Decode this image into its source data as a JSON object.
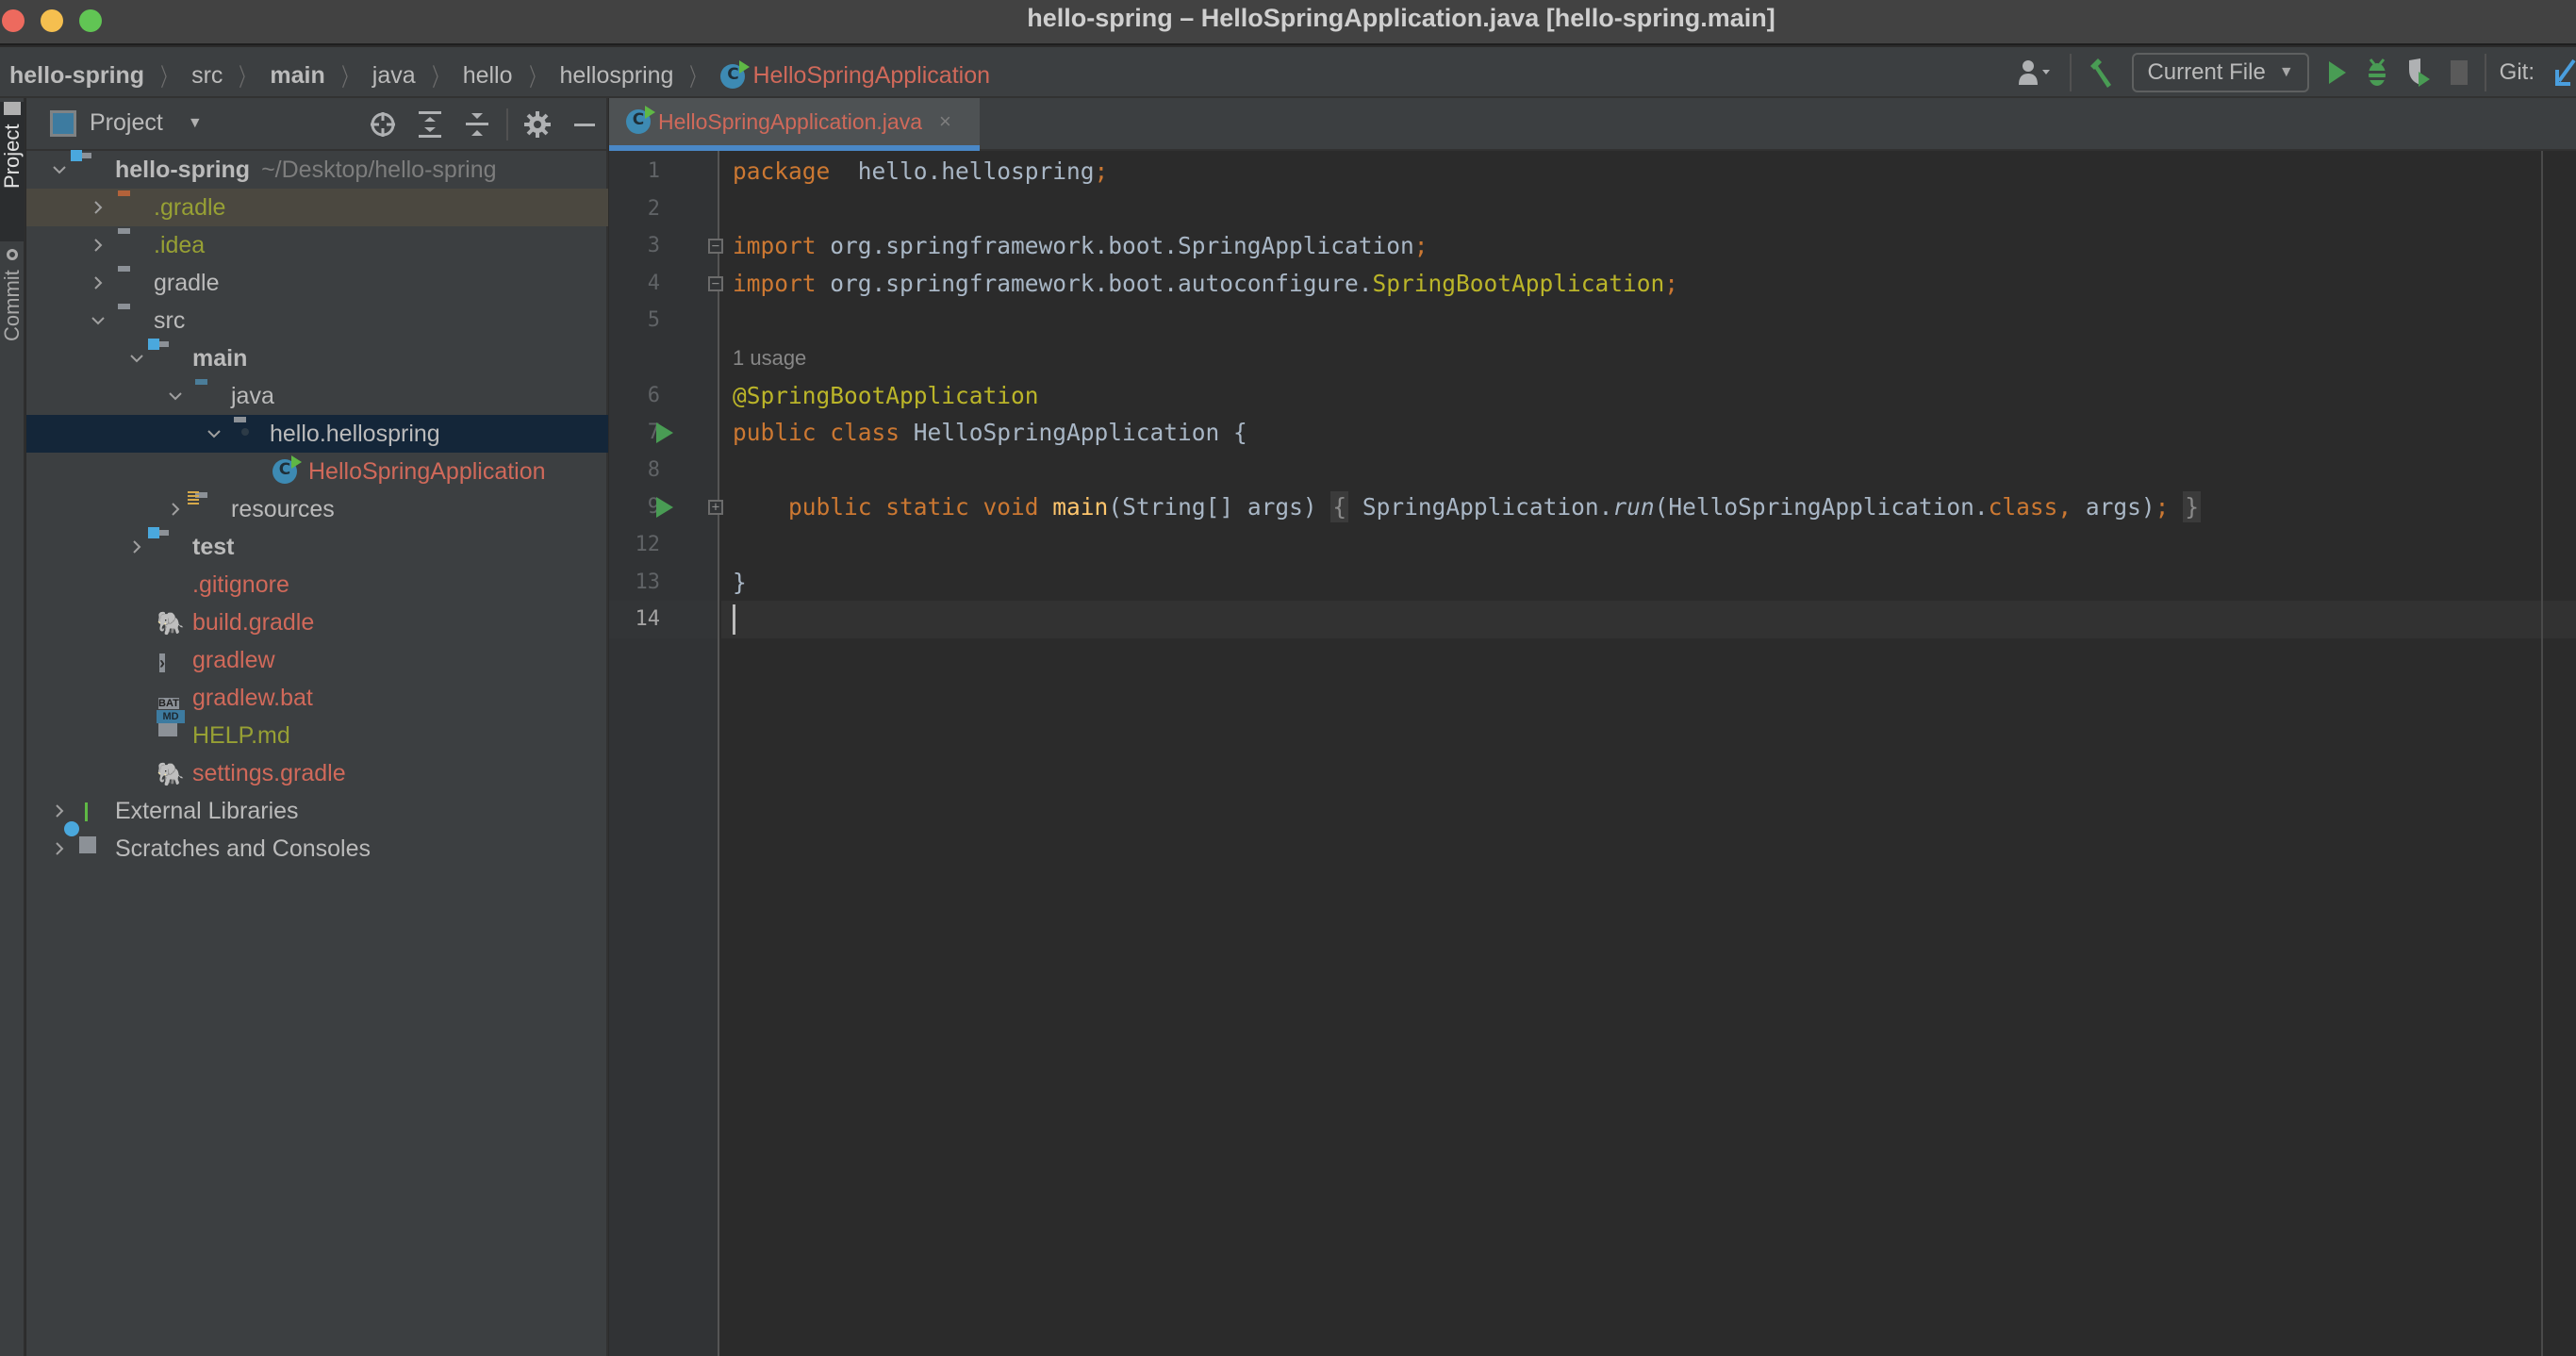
{
  "window": {
    "title": "hello-spring – HelloSpringApplication.java [hello-spring.main]"
  },
  "breadcrumb": {
    "items": [
      "hello-spring",
      "src",
      "main",
      "java",
      "hello",
      "hellospring",
      "HelloSpringApplication"
    ]
  },
  "toolbar": {
    "account_icon": "user-icon",
    "build_icon": "hammer-icon",
    "run_config": "Current File",
    "run_icon": "run-icon",
    "debug_icon": "bug-icon",
    "coverage_icon": "coverage-icon",
    "stop_icon": "stop-icon",
    "git_label": "Git:",
    "git_update_icon": "git-update-arrow-icon"
  },
  "left_strip": {
    "tabs": [
      "Project",
      "Commit"
    ]
  },
  "project_panel": {
    "title": "Project",
    "tools": [
      "locate-icon",
      "expand-all-icon",
      "collapse-all-icon",
      "gear-icon",
      "hide-icon"
    ],
    "tree": [
      {
        "label": "hello-spring",
        "extra": "~/Desktop/hello-spring",
        "depth": 0,
        "expanded": true,
        "type": "module-folder",
        "style": "bold"
      },
      {
        "label": ".gradle",
        "depth": 1,
        "expanded": false,
        "type": "excluded-folder",
        "style": "olive"
      },
      {
        "label": ".idea",
        "depth": 1,
        "expanded": false,
        "type": "folder",
        "style": "olive"
      },
      {
        "label": "gradle",
        "depth": 1,
        "expanded": false,
        "type": "folder",
        "style": "normal"
      },
      {
        "label": "src",
        "depth": 1,
        "expanded": true,
        "type": "folder",
        "style": "normal"
      },
      {
        "label": "main",
        "depth": 2,
        "expanded": true,
        "type": "module-folder",
        "style": "bold"
      },
      {
        "label": "java",
        "depth": 3,
        "expanded": true,
        "type": "source-folder",
        "style": "normal"
      },
      {
        "label": "hello.hellospring",
        "depth": 4,
        "expanded": true,
        "type": "package",
        "style": "normal",
        "selected": true
      },
      {
        "label": "HelloSpringApplication",
        "depth": 5,
        "type": "java-class",
        "style": "red"
      },
      {
        "label": "resources",
        "depth": 3,
        "expanded": false,
        "type": "resources-folder",
        "style": "normal"
      },
      {
        "label": "test",
        "depth": 2,
        "expanded": false,
        "type": "module-folder",
        "style": "bold"
      },
      {
        "label": ".gitignore",
        "depth": 2,
        "type": "ignore-file",
        "style": "red"
      },
      {
        "label": "build.gradle",
        "depth": 2,
        "type": "gradle-file",
        "style": "red"
      },
      {
        "label": "gradlew",
        "depth": 2,
        "type": "shell-file",
        "style": "red"
      },
      {
        "label": "gradlew.bat",
        "depth": 2,
        "type": "bat-file",
        "style": "red"
      },
      {
        "label": "HELP.md",
        "depth": 2,
        "type": "md-file",
        "style": "olive"
      },
      {
        "label": "settings.gradle",
        "depth": 2,
        "type": "gradle-file",
        "style": "red"
      },
      {
        "label": "External Libraries",
        "depth": 0,
        "expanded": false,
        "type": "libraries",
        "style": "normal"
      },
      {
        "label": "Scratches and Consoles",
        "depth": 0,
        "expanded": false,
        "type": "scratches",
        "style": "normal"
      }
    ]
  },
  "editor": {
    "tab": {
      "label": "HelloSpringApplication.java",
      "close": "×"
    },
    "usage_hint": "1 usage",
    "current_line": 14,
    "lines": [
      {
        "n": "1",
        "tokens": [
          [
            "kw",
            "package"
          ],
          [
            "",
            "  hello.hellospring"
          ],
          [
            "kw",
            ";"
          ]
        ]
      },
      {
        "n": "2",
        "tokens": []
      },
      {
        "n": "3",
        "fold": "minus",
        "tokens": [
          [
            "kw",
            "import"
          ],
          [
            "",
            " org.springframework.boot.SpringApplication"
          ],
          [
            "kw",
            ";"
          ]
        ]
      },
      {
        "n": "4",
        "fold": "minus",
        "tokens": [
          [
            "kw",
            "import"
          ],
          [
            "",
            " org.springframework.boot.autoconfigure."
          ],
          [
            "ann",
            "SpringBootApplication"
          ],
          [
            "kw",
            ";"
          ]
        ]
      },
      {
        "n": "5",
        "tokens": []
      },
      {
        "n": "",
        "hint": true,
        "tokens": []
      },
      {
        "n": "6",
        "tokens": [
          [
            "ann",
            "@SpringBootApplication"
          ]
        ]
      },
      {
        "n": "7",
        "run": true,
        "tokens": [
          [
            "kw",
            "public class"
          ],
          [
            "",
            " HelloSpringApplication {"
          ]
        ]
      },
      {
        "n": "8",
        "tokens": []
      },
      {
        "n": "9",
        "run": true,
        "fold": "plus",
        "tokens": [
          [
            "",
            "    "
          ],
          [
            "kw",
            "public static void"
          ],
          [
            "",
            " "
          ],
          [
            "fn",
            "main"
          ],
          [
            "",
            "(String[] args) "
          ],
          [
            "fold-bracket",
            "{"
          ],
          [
            "",
            " SpringApplication."
          ],
          [
            "it",
            "run"
          ],
          [
            "",
            "(HelloSpringApplication."
          ],
          [
            "kw",
            "class,"
          ],
          [
            "",
            " args)"
          ],
          [
            "kw",
            ";"
          ],
          [
            "",
            " "
          ],
          [
            "fold-bracket",
            "}"
          ]
        ]
      },
      {
        "n": "12",
        "tokens": []
      },
      {
        "n": "13",
        "tokens": [
          [
            "",
            "}"
          ]
        ]
      },
      {
        "n": "14",
        "cursor": true,
        "tokens": []
      }
    ]
  },
  "colors": {
    "keyword": "#cc7832",
    "annotation": "#bbb529",
    "method": "#ffc66d",
    "plain": "#a9b7c6",
    "modified_file": "#d0695a",
    "unversioned_file": "#97a034",
    "tab_underline": "#4a88c7",
    "run_marker": "#499c54"
  }
}
